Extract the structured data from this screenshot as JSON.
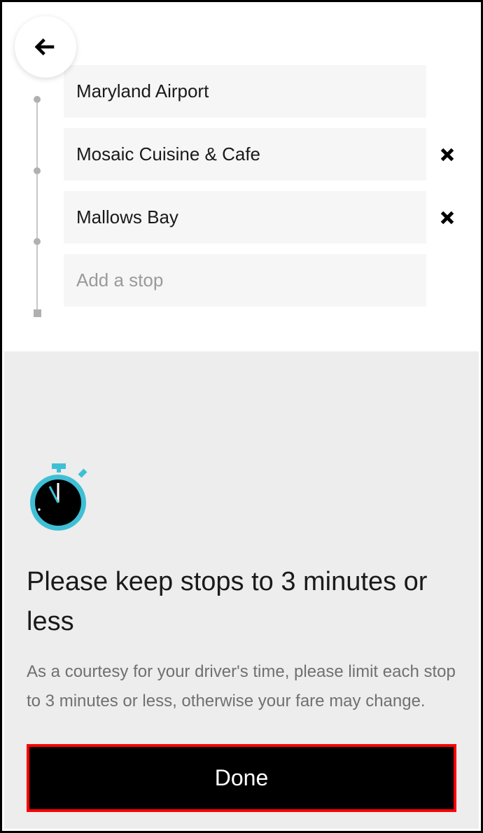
{
  "stops": {
    "items": [
      {
        "label": "Maryland Airport",
        "removable": false
      },
      {
        "label": "Mosaic Cuisine & Cafe",
        "removable": true
      },
      {
        "label": "Mallows Bay",
        "removable": true
      }
    ],
    "add_placeholder": "Add a stop"
  },
  "sheet": {
    "title": "Please keep stops to 3 minutes or less",
    "body": "As a courtesy for your driver's time, please limit each stop to 3 minutes or less, otherwise your fare may change.",
    "done_label": "Done"
  }
}
